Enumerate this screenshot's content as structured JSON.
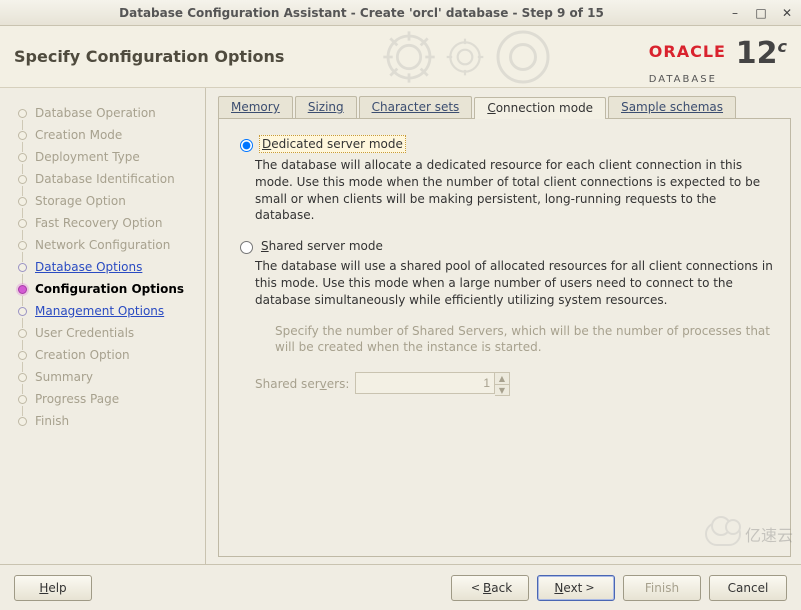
{
  "window": {
    "title": "Database Configuration Assistant - Create 'orcl' database - Step 9 of 15"
  },
  "header": {
    "title": "Specify Configuration Options",
    "brand_name": "ORACLE",
    "brand_sub": "DATABASE",
    "version_major": "12",
    "version_suffix": "c"
  },
  "sidebar": {
    "items": [
      {
        "label": "Database Operation",
        "state": "disabled"
      },
      {
        "label": "Creation Mode",
        "state": "disabled"
      },
      {
        "label": "Deployment Type",
        "state": "disabled"
      },
      {
        "label": "Database Identification",
        "state": "disabled"
      },
      {
        "label": "Storage Option",
        "state": "disabled"
      },
      {
        "label": "Fast Recovery Option",
        "state": "disabled"
      },
      {
        "label": "Network Configuration",
        "state": "disabled"
      },
      {
        "label": "Database Options",
        "state": "link"
      },
      {
        "label": "Configuration Options",
        "state": "current"
      },
      {
        "label": "Management Options",
        "state": "link"
      },
      {
        "label": "User Credentials",
        "state": "disabled"
      },
      {
        "label": "Creation Option",
        "state": "disabled"
      },
      {
        "label": "Summary",
        "state": "disabled"
      },
      {
        "label": "Progress Page",
        "state": "disabled"
      },
      {
        "label": "Finish",
        "state": "disabled"
      }
    ]
  },
  "tabs": [
    {
      "label": "Memory",
      "active": false
    },
    {
      "label": "Sizing",
      "active": false
    },
    {
      "label": "Character sets",
      "active": false
    },
    {
      "label": "Connection mode",
      "active": true
    },
    {
      "label": "Sample schemas",
      "active": false
    }
  ],
  "connection_mode": {
    "dedicated": {
      "label": "Dedicated server mode",
      "selected": true,
      "desc": "The database will allocate a dedicated resource for each client connection in this mode. Use this mode when the number of total client connections is expected to be small or when clients will be making persistent, long-running requests to the database."
    },
    "shared": {
      "label": "Shared server mode",
      "selected": false,
      "desc": "The database will use a shared pool of allocated resources for all client connections in this mode.  Use this mode when a large number of users need to connect to the database simultaneously while efficiently utilizing system resources.",
      "hint": "Specify the number of Shared Servers, which will be the number of processes that will be created when the instance is started.",
      "field_label": "Shared servers:",
      "field_value": "1"
    }
  },
  "footer": {
    "help": "Help",
    "back": "Back",
    "next": "Next",
    "cancel": "Cancel",
    "finish": "Finish"
  },
  "watermark": "亿速云"
}
